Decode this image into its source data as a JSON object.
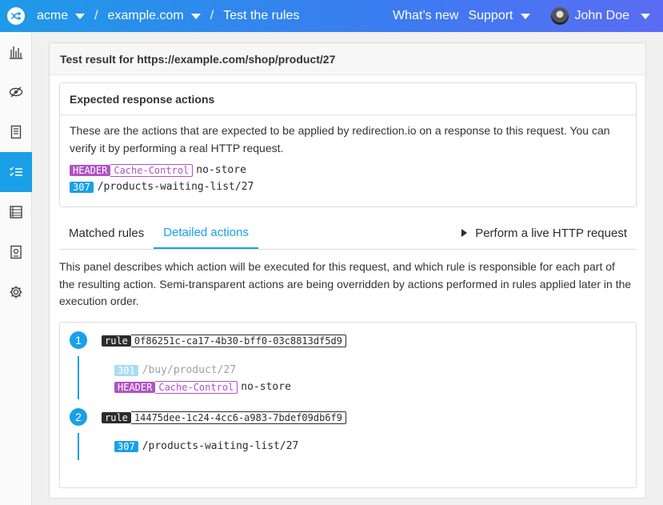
{
  "topbar": {
    "org": "acme",
    "project": "example.com",
    "page": "Test the rules",
    "whats_new": "What’s new",
    "support": "Support",
    "user": "John Doe"
  },
  "sidebar": {
    "items": [
      {
        "icon": "chart-icon"
      },
      {
        "icon": "eye-off-icon"
      },
      {
        "icon": "document-icon"
      },
      {
        "icon": "checklist-icon",
        "active": true
      },
      {
        "icon": "list-icon"
      },
      {
        "icon": "certificate-icon"
      },
      {
        "icon": "gear-icon"
      }
    ]
  },
  "result": {
    "title": "Test result for https://example.com/shop/product/27"
  },
  "expected": {
    "title": "Expected response actions",
    "description": "These are the actions that are expected to be applied by redirection.io on a response to this request. You can verify it by performing a real HTTP request.",
    "header_label": "HEADER",
    "header_name": "Cache-Control",
    "header_value": "no-store",
    "status_code": "307",
    "status_target": "/products-waiting-list/27"
  },
  "tabs": {
    "matched": "Matched rules",
    "detailed": "Detailed actions",
    "live": "Perform a live HTTP request"
  },
  "detailed": {
    "description": "This panel describes which action will be executed for this request, and which rule is responsible for each part of the resulting action. Semi-transparent actions are being overridden by actions performed in rules applied later in the execution order.",
    "rule_label": "rule",
    "steps": [
      {
        "number": "1",
        "rule_id": "0f86251c-ca17-4b30-bff0-03c8813df5d9",
        "status_code": "301",
        "status_target": "/buy/product/27",
        "header_label": "HEADER",
        "header_name": "Cache-Control",
        "header_value": "no-store"
      },
      {
        "number": "2",
        "rule_id": "14475dee-1c24-4cc6-a983-7bdef09db6f9",
        "status_code": "307",
        "status_target": "/products-waiting-list/27"
      }
    ]
  },
  "colors": {
    "accent": "#1aa0e6",
    "header_badge": "#b052c4",
    "rule_badge": "#2c2c2c"
  }
}
